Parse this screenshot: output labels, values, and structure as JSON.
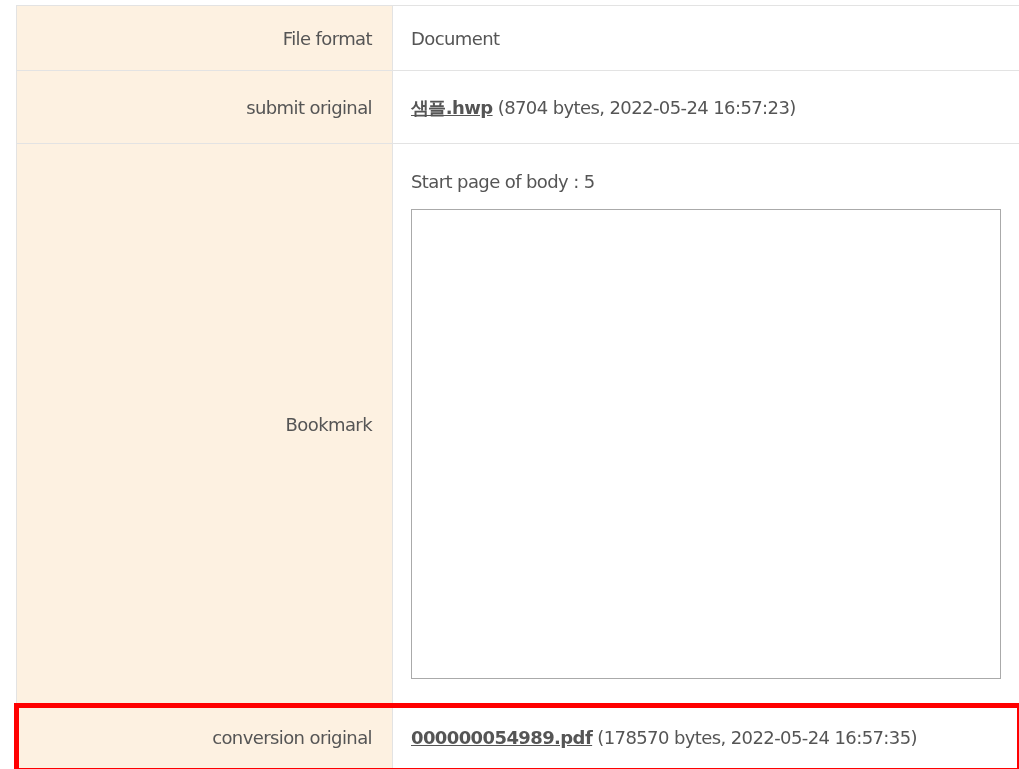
{
  "rows": [
    {
      "kind": "text",
      "label": "File format",
      "value": "Document",
      "highlighted": false
    },
    {
      "kind": "file",
      "label": "submit original",
      "link": "샘플.hwp",
      "details": "(8704 bytes, 2022-05-24 16:57:23)",
      "highlighted": false
    },
    {
      "kind": "bookmark",
      "label": "Bookmark",
      "note": "Start page of body : 5",
      "highlighted": false
    },
    {
      "kind": "file",
      "label": "conversion original",
      "link": "000000054989.pdf",
      "details": "(178570 bytes, 2022-05-24 16:57:35)",
      "highlighted": true
    }
  ]
}
